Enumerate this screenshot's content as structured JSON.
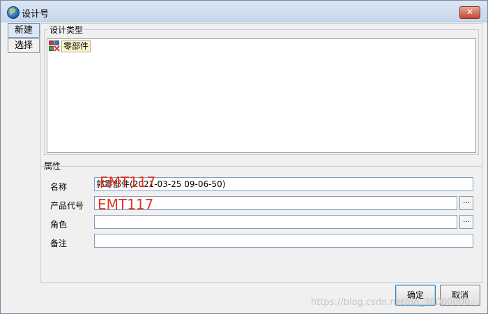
{
  "window": {
    "title": "设计号"
  },
  "tabs": [
    {
      "label": "新建",
      "active": true
    },
    {
      "label": "选择",
      "active": false
    }
  ],
  "design_type": {
    "legend": "设计类型",
    "items": [
      {
        "label": "零部件",
        "icon": "part-icon"
      }
    ]
  },
  "attributes": {
    "legend": "属性",
    "name": {
      "label": "名称",
      "value": "郭零部件(2021-03-25  09-06-50)",
      "overlay": "EMT117"
    },
    "product_code": {
      "label": "产品代号",
      "value": "",
      "overlay": "EMT117",
      "browse": "..."
    },
    "role": {
      "label": "角色",
      "value": "",
      "browse": "..."
    },
    "remark": {
      "label": "备注",
      "value": ""
    }
  },
  "buttons": {
    "ok": "确定",
    "cancel": "取消"
  },
  "watermark": "https://blog.csdn.net/qq_30000000",
  "colors": {
    "overlay_red": "#e5311f",
    "close_red": "#c44a33"
  }
}
